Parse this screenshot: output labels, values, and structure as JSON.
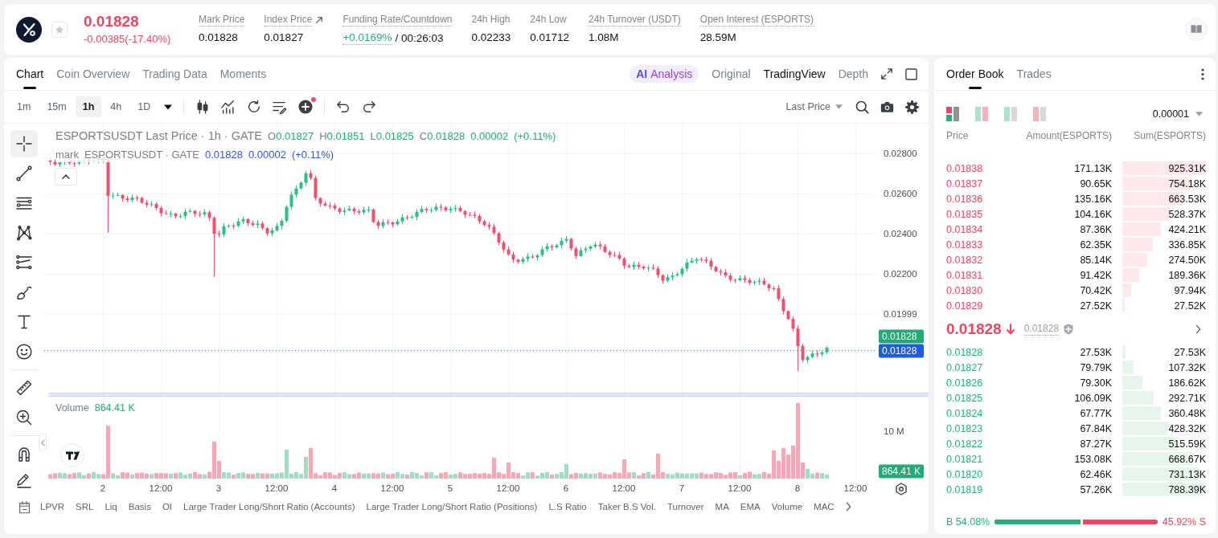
{
  "header": {
    "price": "0.01828",
    "change": "-0.00385(-17.40%)",
    "falling": true,
    "favorite": false,
    "stats": [
      {
        "kind": "plain",
        "label": "Mark Price",
        "value": "0.01828",
        "dotted": true
      },
      {
        "kind": "link",
        "label": "Index Price",
        "value": "0.01827",
        "dotted": true
      },
      {
        "kind": "rate",
        "label": "Funding Rate/Countdown",
        "value": "+0.0169%",
        "countdown": "/ 00:26:03",
        "dotted": true
      },
      {
        "kind": "plain",
        "label": "24h High",
        "value": "0.02233",
        "dotted": false
      },
      {
        "kind": "plain",
        "label": "24h Low",
        "value": "0.01712",
        "dotted": false
      },
      {
        "kind": "plain",
        "label": "24h Turnover (USDT)",
        "value": "1.08M",
        "dotted": true
      },
      {
        "kind": "plain",
        "label": "Open Interest (ESPORTS)",
        "value": "28.59M",
        "dotted": true
      }
    ]
  },
  "chart_panel": {
    "tabs": [
      {
        "label": "Chart",
        "selected": true
      },
      {
        "label": "Coin Overview",
        "selected": false
      },
      {
        "label": "Trading Data",
        "selected": false
      },
      {
        "label": "Moments",
        "selected": false
      }
    ],
    "analysis": {
      "badge": "AI",
      "label": "Analysis"
    },
    "views": [
      {
        "label": "Original",
        "selected": false
      },
      {
        "label": "TradingView",
        "selected": true
      },
      {
        "label": "Depth",
        "selected": false
      }
    ],
    "intervals": [
      {
        "label": "1m",
        "selected": false
      },
      {
        "label": "15m",
        "selected": false
      },
      {
        "label": "1h",
        "selected": true
      },
      {
        "label": "4h",
        "selected": false
      },
      {
        "label": "1D",
        "selected": false
      }
    ],
    "indicator_alert": true,
    "price_source": "Last Price",
    "drawing_tools": [
      [
        {
          "kind": "crosshair",
          "selected": true
        },
        {
          "kind": "trend_line",
          "selected": false
        },
        {
          "kind": "fib",
          "selected": false
        },
        {
          "kind": "pattern",
          "selected": false
        },
        {
          "kind": "regression",
          "selected": false
        },
        {
          "kind": "brush",
          "selected": false
        },
        {
          "kind": "text",
          "selected": false
        },
        {
          "kind": "emoji",
          "selected": false
        }
      ],
      [
        {
          "kind": "ruler",
          "selected": false
        },
        {
          "kind": "zoom",
          "selected": false
        }
      ],
      [
        {
          "kind": "magnet",
          "selected": false
        },
        {
          "kind": "pencil",
          "selected": false
        }
      ]
    ],
    "legend": {
      "title": "ESPORTSUSDT Last Price · 1h · GATE",
      "ohlc": [
        {
          "label": "O",
          "value": "0.01827"
        },
        {
          "label": "H",
          "value": "0.01851"
        },
        {
          "label": "L",
          "value": "0.01825"
        },
        {
          "label": "C",
          "value": "0.01828"
        }
      ],
      "change": "0.00002",
      "change_pct": "(+0.11%)"
    },
    "mark_legend": {
      "label": "mark",
      "title": "ESPORTSUSDT · GATE",
      "price": "0.01828",
      "change": "0.00002",
      "change_pct": "(+0.11%)"
    },
    "price_axis": [
      "0.02800",
      "0.02600",
      "0.02400",
      "0.02200",
      "0.01999"
    ],
    "last_price_tag": "0.01828",
    "mark_price_tag": "0.01828",
    "volume": {
      "label": "Volume",
      "value": "864.41 K",
      "axis": "10 M",
      "tag": "864.41 K"
    },
    "time_axis": [
      "2",
      "12:00",
      "3",
      "12:00",
      "4",
      "12:00",
      "5",
      "12:00",
      "6",
      "12:00",
      "7",
      "12:00",
      "8",
      "12:00"
    ],
    "indicators": [
      "LPVR",
      "SRL",
      "Liq",
      "Basis",
      "OI",
      "Large Trader Long/Short Ratio (Accounts)",
      "Large Trader Long/Short Ratio (Positions)",
      "L.S Ratio",
      "Taker B.S Vol.",
      "Turnover",
      "MA",
      "EMA",
      "Volume",
      "MAC"
    ]
  },
  "order_book": {
    "tabs": [
      {
        "label": "Order Book",
        "selected": true
      },
      {
        "label": "Trades",
        "selected": false
      }
    ],
    "layouts": [
      {
        "kind": "both",
        "selected": true
      },
      {
        "kind": "split",
        "selected": false
      },
      {
        "kind": "bids",
        "selected": false
      },
      {
        "kind": "asks",
        "selected": false
      }
    ],
    "precision": "0.00001",
    "columns": [
      "Price",
      "Amount(ESPORTS)",
      "Sum(ESPORTS)"
    ],
    "asks": [
      {
        "price": "0.01838",
        "amount": "171.13K",
        "sum": "925.31K"
      },
      {
        "price": "0.01837",
        "amount": "90.65K",
        "sum": "754.18K"
      },
      {
        "price": "0.01836",
        "amount": "135.16K",
        "sum": "663.53K"
      },
      {
        "price": "0.01835",
        "amount": "104.16K",
        "sum": "528.37K"
      },
      {
        "price": "0.01834",
        "amount": "87.36K",
        "sum": "424.21K"
      },
      {
        "price": "0.01833",
        "amount": "62.35K",
        "sum": "336.85K"
      },
      {
        "price": "0.01832",
        "amount": "85.14K",
        "sum": "274.50K"
      },
      {
        "price": "0.01831",
        "amount": "91.42K",
        "sum": "189.36K"
      },
      {
        "price": "0.01830",
        "amount": "70.42K",
        "sum": "97.94K"
      },
      {
        "price": "0.01829",
        "amount": "27.52K",
        "sum": "27.52K"
      }
    ],
    "last_price": "0.01828",
    "falling": true,
    "mark_price": "0.01828",
    "bids": [
      {
        "price": "0.01828",
        "amount": "27.53K",
        "sum": "27.53K"
      },
      {
        "price": "0.01827",
        "amount": "79.79K",
        "sum": "107.32K"
      },
      {
        "price": "0.01826",
        "amount": "79.30K",
        "sum": "186.62K"
      },
      {
        "price": "0.01825",
        "amount": "106.09K",
        "sum": "292.71K"
      },
      {
        "price": "0.01824",
        "amount": "67.77K",
        "sum": "360.48K"
      },
      {
        "price": "0.01823",
        "amount": "67.84K",
        "sum": "428.32K"
      },
      {
        "price": "0.01822",
        "amount": "87.27K",
        "sum": "515.59K"
      },
      {
        "price": "0.01821",
        "amount": "153.08K",
        "sum": "668.67K"
      },
      {
        "price": "0.01820",
        "amount": "62.46K",
        "sum": "731.13K"
      },
      {
        "price": "0.01819",
        "amount": "57.26K",
        "sum": "788.39K"
      }
    ],
    "ratio": {
      "buy": "B 54.08%",
      "sell": "45.92% S",
      "level": 0.5408
    }
  }
}
